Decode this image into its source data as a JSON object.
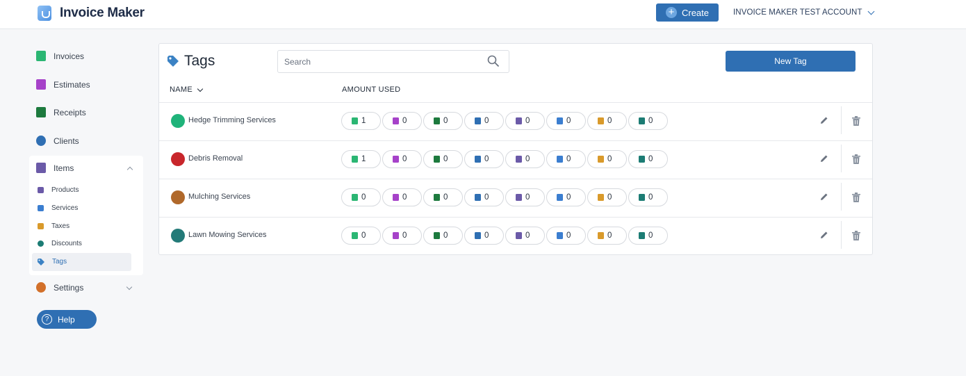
{
  "header": {
    "app_name": "Invoice Maker",
    "create_label": "Create",
    "account_name": "INVOICE MAKER TEST ACCOUNT"
  },
  "sidebar": {
    "items": [
      {
        "label": "Invoices",
        "icon": "invoice-icon",
        "color": "#2bb673"
      },
      {
        "label": "Estimates",
        "icon": "estimate-icon",
        "color": "#a642c9"
      },
      {
        "label": "Receipts",
        "icon": "receipt-icon",
        "color": "#1d7a3e"
      },
      {
        "label": "Clients",
        "icon": "clients-icon",
        "color": "#2f6fb3"
      },
      {
        "label": "Items",
        "icon": "items-icon",
        "color": "#6b5aa8"
      }
    ],
    "subitems": [
      {
        "label": "Products",
        "icon": "products-icon",
        "color": "#6b5aa8"
      },
      {
        "label": "Services",
        "icon": "services-icon",
        "color": "#3b7ed0"
      },
      {
        "label": "Taxes",
        "icon": "taxes-icon",
        "color": "#d99a2b"
      },
      {
        "label": "Discounts",
        "icon": "discounts-icon",
        "color": "#1c7c74"
      },
      {
        "label": "Tags",
        "icon": "tag-icon",
        "color": "#3b82c4"
      }
    ],
    "settings_label": "Settings",
    "help_label": "Help"
  },
  "main": {
    "title": "Tags",
    "search_placeholder": "Search",
    "new_tag_label": "New Tag",
    "col_name": "NAME",
    "col_amount": "AMOUNT USED"
  },
  "pill_icons": [
    {
      "icon": "invoice-icon",
      "color": "#2bb673"
    },
    {
      "icon": "estimate-icon",
      "color": "#a642c9"
    },
    {
      "icon": "receipt-icon",
      "color": "#1d7a3e"
    },
    {
      "icon": "clients-icon",
      "color": "#2f6fb3"
    },
    {
      "icon": "products-icon",
      "color": "#6b5aa8"
    },
    {
      "icon": "services-icon",
      "color": "#3b7ed0"
    },
    {
      "icon": "taxes-icon",
      "color": "#d99a2b"
    },
    {
      "icon": "discounts-icon",
      "color": "#1c7c74"
    }
  ],
  "tags": [
    {
      "name": "Hedge Trimming Services",
      "color": "#1fb37a",
      "counts": [
        "1",
        "0",
        "0",
        "0",
        "0",
        "0",
        "0",
        "0"
      ]
    },
    {
      "name": "Debris Removal",
      "color": "#c8262b",
      "counts": [
        "1",
        "0",
        "0",
        "0",
        "0",
        "0",
        "0",
        "0"
      ]
    },
    {
      "name": "Mulching Services",
      "color": "#b0682a",
      "counts": [
        "0",
        "0",
        "0",
        "0",
        "0",
        "0",
        "0",
        "0"
      ]
    },
    {
      "name": "Lawn Mowing Services",
      "color": "#237a78",
      "counts": [
        "0",
        "0",
        "0",
        "0",
        "0",
        "0",
        "0",
        "0"
      ]
    }
  ]
}
